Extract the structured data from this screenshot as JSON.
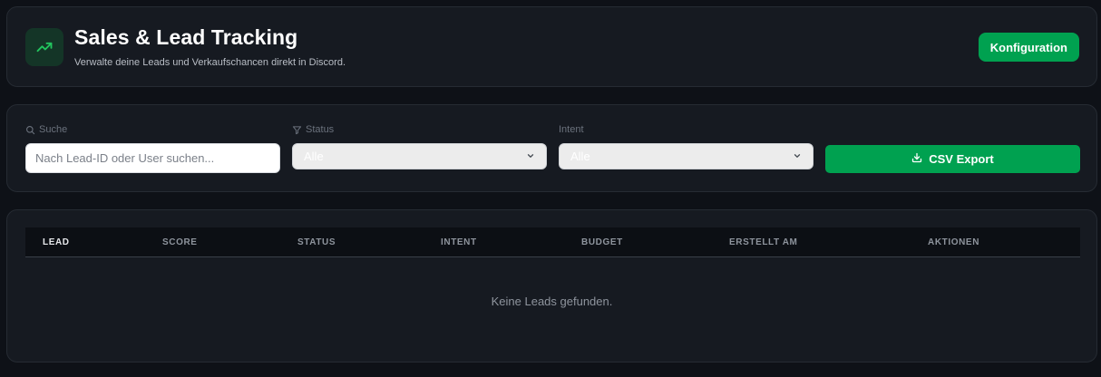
{
  "header": {
    "title": "Sales & Lead Tracking",
    "subtitle": "Verwalte deine Leads und Verkaufschancen direkt in Discord.",
    "logo_icon": "trending-up-icon",
    "config_label": "Konfiguration"
  },
  "filters": {
    "search": {
      "label": "Suche",
      "icon": "search-icon",
      "value": "",
      "placeholder": "Nach Lead-ID oder User suchen..."
    },
    "status": {
      "label": "Status",
      "icon": "filter-icon",
      "value": "Alle"
    },
    "intent": {
      "label": "Intent",
      "value": "Alle"
    },
    "export_label": "CSV Export",
    "export_icon": "download-icon"
  },
  "table": {
    "columns": [
      "LEAD",
      "SCORE",
      "STATUS",
      "INTENT",
      "BUDGET",
      "ERSTELLT AM",
      "AKTIONEN"
    ],
    "rows": [],
    "empty_message": "Keine Leads gefunden."
  },
  "colors": {
    "accent": "#00a150",
    "background": "#0e1117",
    "card": "#161a21"
  }
}
